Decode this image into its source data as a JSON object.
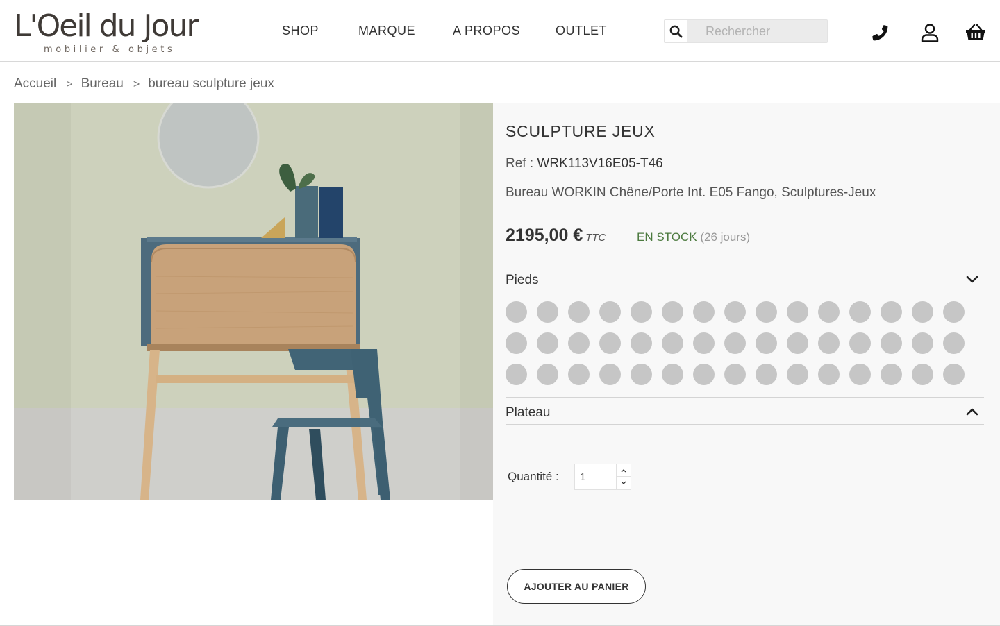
{
  "logo": {
    "main": "L'Oeil du Jour",
    "sub": "mobilier & objets"
  },
  "nav": {
    "items": [
      "SHOP",
      "MARQUE",
      "A PROPOS",
      "OUTLET"
    ]
  },
  "search": {
    "placeholder": "Rechercher",
    "value": ""
  },
  "header_icons": [
    "search-icon",
    "phone-icon",
    "user-icon",
    "basket-icon"
  ],
  "breadcrumb": {
    "items": [
      "Accueil",
      "Bureau",
      "bureau sculpture jeux"
    ],
    "separator": ">"
  },
  "product": {
    "title": "SCULPTURE JEUX",
    "ref_label": "Ref : ",
    "ref_value": "WRK113V16E05-T46",
    "description": "Bureau WORKIN Chêne/Porte Int. E05 Fango, Sculptures-Jeux",
    "price": "2195,00 €",
    "price_suffix": "TTC",
    "stock_label": "EN STOCK",
    "stock_days": "(26 jours)"
  },
  "options": [
    {
      "label": "Pieds",
      "state": "expanded",
      "chevron": "chevron-down-icon",
      "swatch_count": 45,
      "swatch_color": "#c6c6c6"
    },
    {
      "label": "Plateau",
      "state": "collapsed",
      "chevron": "chevron-up-icon"
    }
  ],
  "quantity": {
    "label": "Quantité :",
    "value": "1"
  },
  "cart_button": {
    "label": "AJOUTER AU PANIER"
  },
  "colors": {
    "stock_green": "#4c7a3f",
    "panel_bg": "#f8f8f8",
    "swatch": "#c6c6c6"
  }
}
